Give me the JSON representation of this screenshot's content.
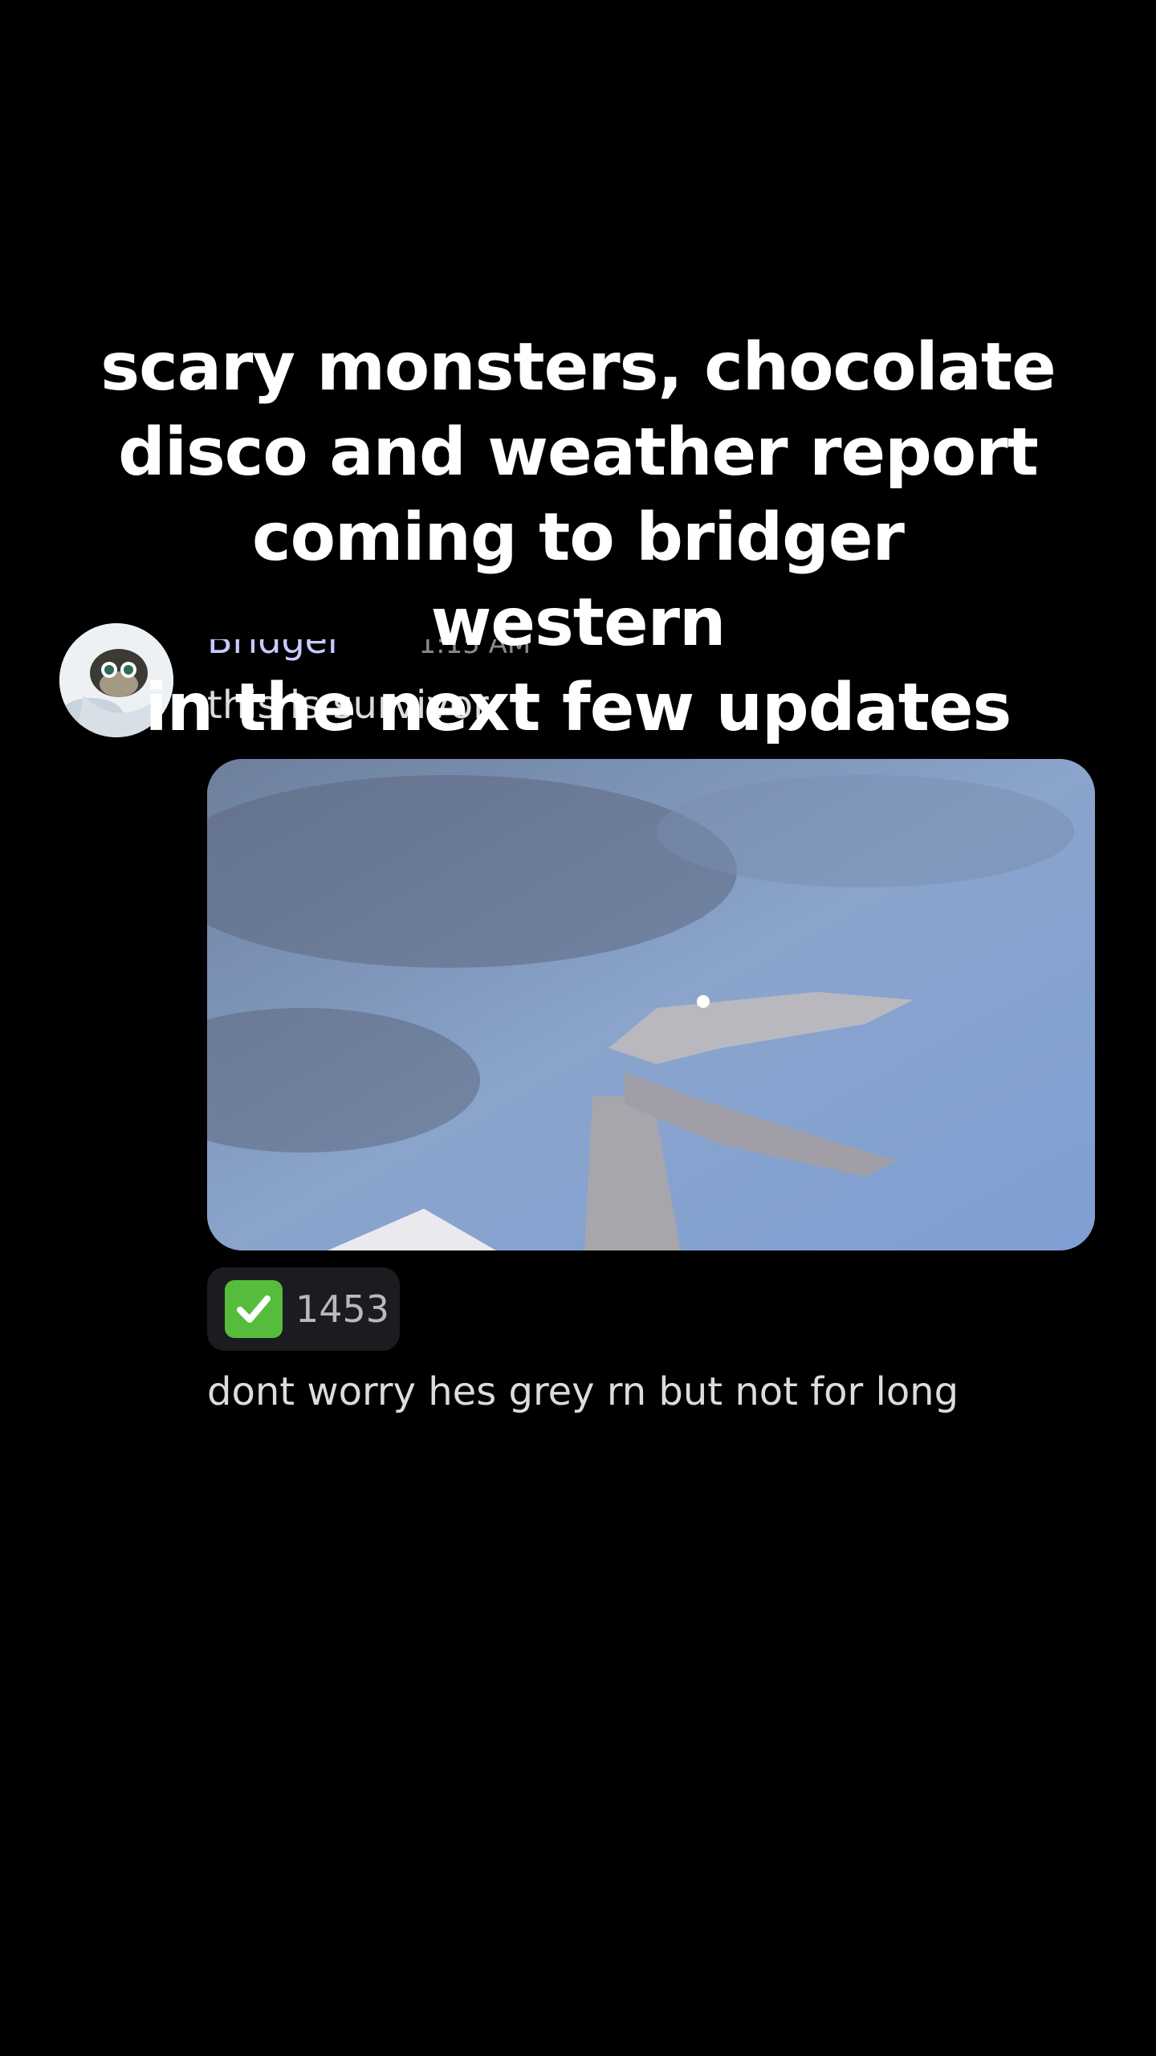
{
  "caption": {
    "lines": [
      "scary monsters, chocolate",
      "disco and weather report",
      "coming to bridger western",
      "in the next few updates"
    ]
  },
  "message": {
    "username": "Bridger",
    "timestamp": "1:15 AM",
    "text_1": "this is survivor",
    "reaction": {
      "emoji": "check-mark-button-emoji",
      "count": "1453"
    },
    "text_2": "dont worry hes grey rn but not for long"
  },
  "colors": {
    "background": "#000000",
    "reaction_bg": "#1b1c20",
    "check_green": "#56bd3c",
    "sky": "#7f9bc7"
  }
}
